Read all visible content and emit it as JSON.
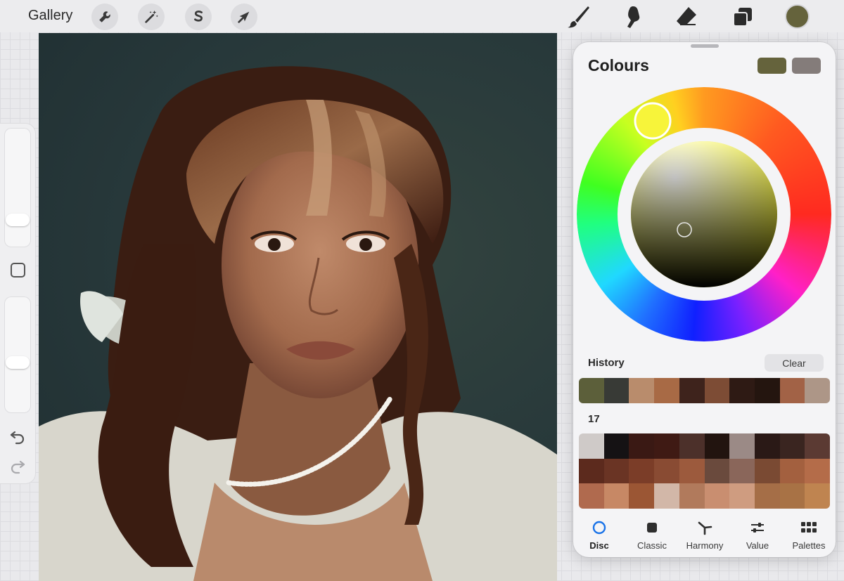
{
  "toolbar": {
    "gallery_label": "Gallery",
    "left_tools": [
      "wrench-icon",
      "magic-wand-icon",
      "selection-s-icon",
      "transform-arrow-icon"
    ],
    "right_tools": [
      "brush-icon",
      "smudge-icon",
      "eraser-icon",
      "layers-icon"
    ],
    "current_color": "#65633c"
  },
  "sidebar": {
    "brush_size_level": 0.18,
    "opacity_level": 0.42
  },
  "panel": {
    "title": "Colours",
    "primary_color": "#65633c",
    "secondary_color": "#847c7a",
    "history_label": "History",
    "clear_label": "Clear",
    "history_colors": [
      "#5c5f3a",
      "#383a36",
      "#b98c6c",
      "#a86a45",
      "#3e231c",
      "#7d4c35",
      "#2e1a14",
      "#24150f",
      "#a26246",
      "#ad9687"
    ],
    "palette_name": "17",
    "palette_colors": [
      "#cfcac8",
      "#151214",
      "#3a1914",
      "#3f1a14",
      "#4c302a",
      "#22140f",
      "#9b8a86",
      "#2a1916",
      "#3a2520",
      "#5b3a33",
      "#5c2a1d",
      "#6a3424",
      "#7b3d28",
      "#894b33",
      "#9c5a3d",
      "#6a4a3d",
      "#8a665a",
      "#7a4a33",
      "#a3603f",
      "#b46c49",
      "#b06a4e",
      "#c78865",
      "#9b5634",
      "#d2b7a8",
      "#b17a5c",
      "#c98e70",
      "#cf9c80",
      "#a56e47",
      "#a87245",
      "#bf8450"
    ],
    "tabs": [
      {
        "label": "Disc",
        "icon": "disc-icon",
        "active": true
      },
      {
        "label": "Classic",
        "icon": "classic-square-icon",
        "active": false
      },
      {
        "label": "Harmony",
        "icon": "harmony-icon",
        "active": false
      },
      {
        "label": "Value",
        "icon": "value-sliders-icon",
        "active": false
      },
      {
        "label": "Palettes",
        "icon": "palettes-grid-icon",
        "active": false
      }
    ]
  }
}
